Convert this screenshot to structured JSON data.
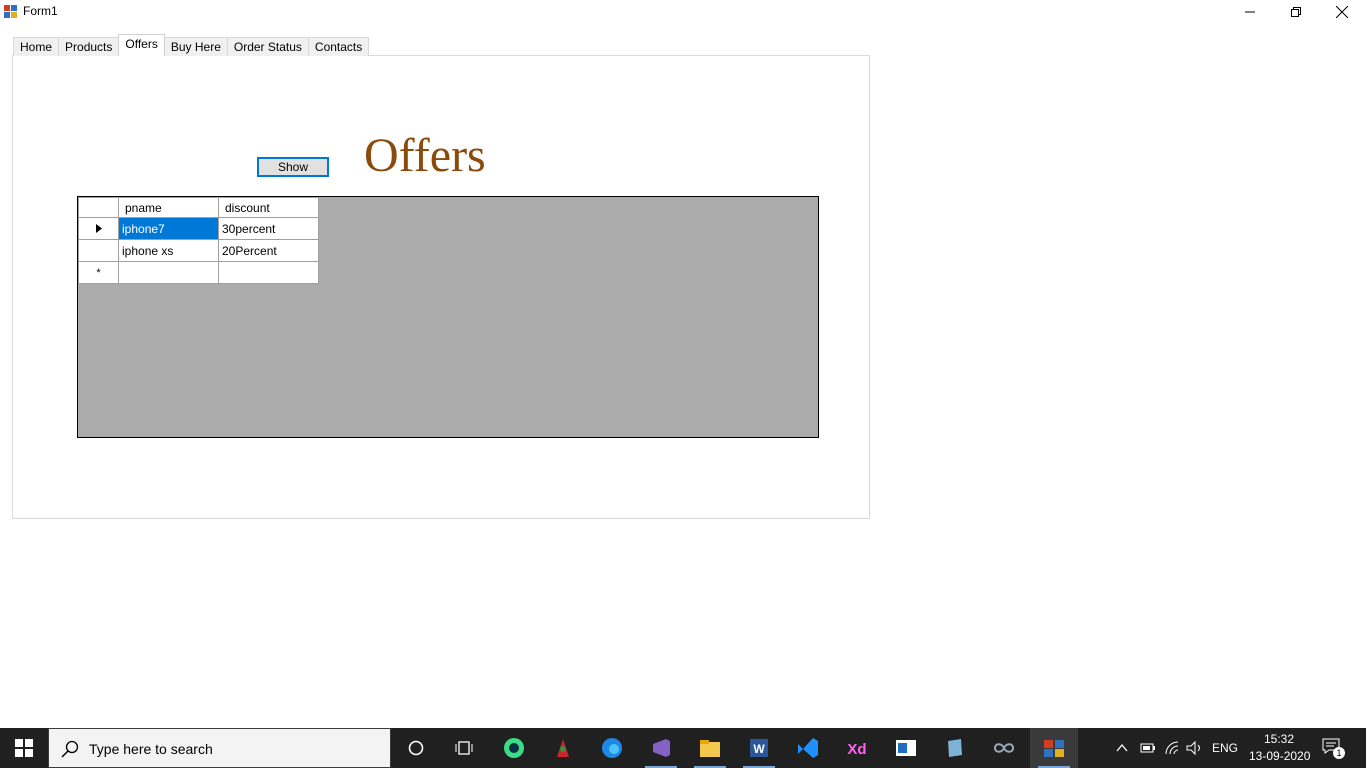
{
  "window": {
    "title": "Form1"
  },
  "tabs": [
    {
      "label": "Home",
      "active": false
    },
    {
      "label": "Products",
      "active": false
    },
    {
      "label": "Offers",
      "active": true
    },
    {
      "label": "Buy Here",
      "active": false
    },
    {
      "label": "Order Status",
      "active": false
    },
    {
      "label": "Contacts",
      "active": false
    }
  ],
  "offers_page": {
    "heading": "Offers",
    "show_button": "Show",
    "heading_color": "#8b4a0a"
  },
  "grid": {
    "columns": [
      "pname",
      "discount"
    ],
    "rows": [
      {
        "pname": "iphone7",
        "discount": "30percent",
        "selected": true,
        "indicator": "►"
      },
      {
        "pname": "iphone xs",
        "discount": "20Percent",
        "selected": false,
        "indicator": ""
      }
    ],
    "new_row_indicator": "*"
  },
  "taskbar": {
    "search_placeholder": "Type here to search",
    "language": "ENG",
    "time": "15:32",
    "date": "13-09-2020",
    "notification_count": "1"
  }
}
